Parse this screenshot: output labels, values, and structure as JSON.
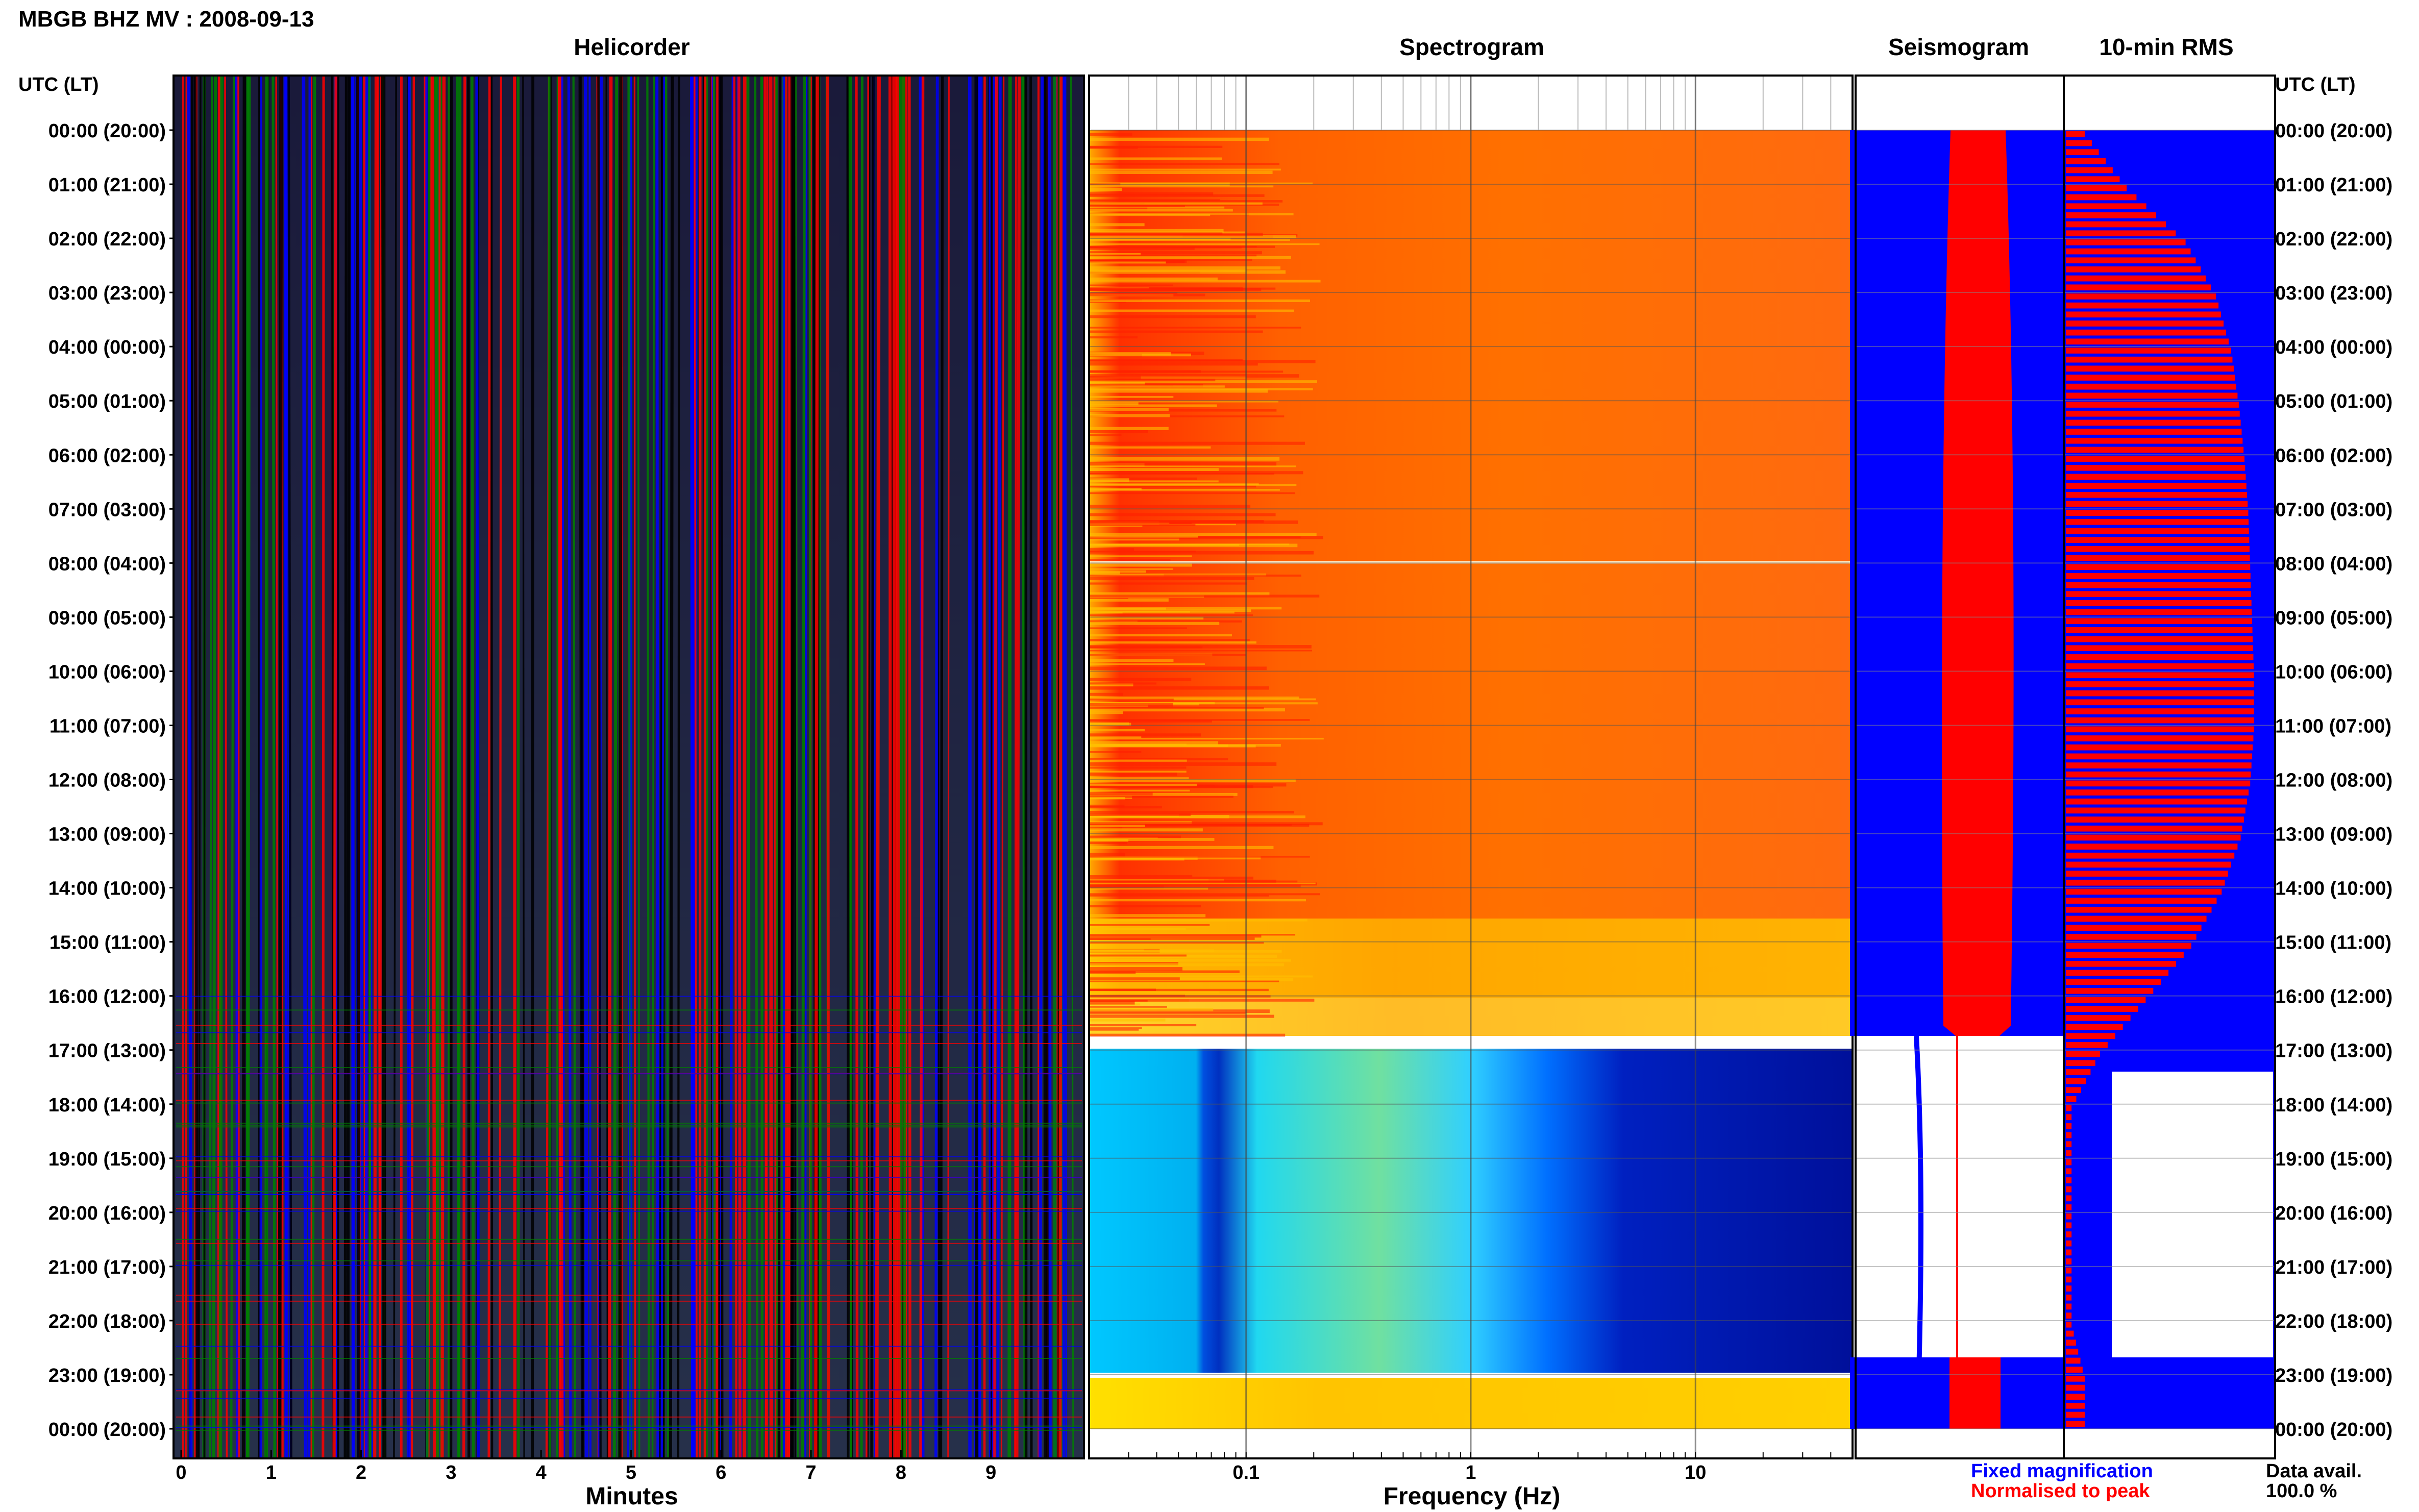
{
  "header": {
    "title": "MBGB BHZ MV : 2008-09-13"
  },
  "panels": {
    "helicorder": "Helicorder",
    "spectrogram": "Spectrogram",
    "seismogram": "Seismogram",
    "rms": "10-min RMS"
  },
  "axes": {
    "left_header": "UTC (LT)",
    "right_header": "UTC (LT)",
    "minutes_label": "Minutes",
    "frequency_label": "Frequency (Hz)"
  },
  "legend": {
    "fixed": "Fixed magnification",
    "normalised": "Normalised to peak",
    "fixed_color": "#0000ff",
    "normalised_color": "#ff0000"
  },
  "data_avail": {
    "label": "Data avail.",
    "value": "100.0 %"
  },
  "chart_data": {
    "type": "heatmap",
    "title": "MBGB BHZ MV : 2008-09-13",
    "time_labels": [
      "00:00 (20:00)",
      "01:00 (21:00)",
      "02:00 (22:00)",
      "03:00 (23:00)",
      "04:00 (00:00)",
      "05:00 (01:00)",
      "06:00 (02:00)",
      "07:00 (03:00)",
      "08:00 (04:00)",
      "09:00 (05:00)",
      "10:00 (06:00)",
      "11:00 (07:00)",
      "12:00 (08:00)",
      "13:00 (09:00)",
      "14:00 (10:00)",
      "15:00 (11:00)",
      "16:00 (12:00)",
      "17:00 (13:00)",
      "18:00 (14:00)",
      "19:00 (15:00)",
      "20:00 (16:00)",
      "21:00 (17:00)",
      "22:00 (18:00)",
      "23:00 (19:00)",
      "00:00 (20:00)"
    ],
    "helicorder": {
      "xlabel": "Minutes",
      "xlim": [
        0,
        10
      ],
      "x_ticks": [
        0,
        1,
        2,
        3,
        4,
        5,
        6,
        7,
        8,
        9
      ],
      "trace_colors": [
        "#000000",
        "#ff0000",
        "#0000ff",
        "#008000"
      ]
    },
    "spectrogram": {
      "xlabel": "Frequency (Hz)",
      "x_scale": "log",
      "xlim": [
        0.02,
        50
      ],
      "x_ticks": [
        0.1,
        1,
        10
      ],
      "x_tick_labels": [
        "0.1",
        "1",
        "10"
      ],
      "quiet_interval_hours": [
        17.3,
        22.9
      ]
    },
    "rms": {
      "series": [
        {
          "name": "Fixed magnification",
          "color": "#0000ff"
        },
        {
          "name": "Normalised to peak",
          "color": "#ff0000"
        }
      ],
      "hourly_level": [
        0.1,
        0.32,
        0.63,
        0.79,
        0.87,
        0.91,
        0.94,
        0.96,
        0.97,
        0.98,
        0.99,
        0.99,
        0.97,
        0.92,
        0.82,
        0.66,
        0.42,
        0.18,
        0.03,
        0.03,
        0.03,
        0.03,
        0.03,
        0.1,
        0.1
      ]
    },
    "grid": true
  }
}
